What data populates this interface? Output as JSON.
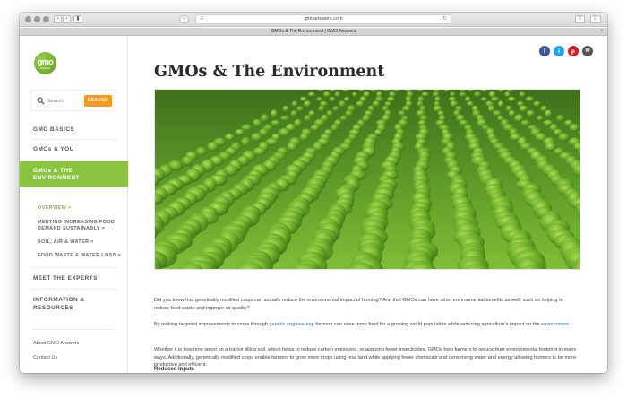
{
  "browser": {
    "url": "gmoanswers.com",
    "tab_title": "GMOs & The Environment | GMO Answers"
  },
  "sidebar": {
    "logo_text": "gmo",
    "logo_sub": "answers",
    "search_placeholder": "Search",
    "search_button": "SEARCH",
    "nav": [
      {
        "label": "GMO BASICS"
      },
      {
        "label": "GMOs & YOU"
      }
    ],
    "active_nav": {
      "line1": "GMOs & THE",
      "line2": "ENVIRONMENT"
    },
    "subnav": [
      {
        "label": "OVERVIEW >"
      },
      {
        "line1": "MEETING INCREASING FOOD",
        "line2": "DEMAND SUSTAINABLY >"
      },
      {
        "label": "SOIL, AIR & WATER >"
      },
      {
        "label": "FOOD WASTE & WATER LOSS >"
      }
    ],
    "nav_after": [
      {
        "label": "MEET THE EXPERTS"
      },
      {
        "line1": "INFORMATION &",
        "line2": "RESOURCES"
      }
    ],
    "footer_links": [
      "About GMO Answers",
      "Contact Us"
    ]
  },
  "main": {
    "title": "GMOs & The Environment",
    "social": [
      {
        "name": "facebook",
        "glyph": "f",
        "color": "#3b5998"
      },
      {
        "name": "twitter",
        "glyph": "t",
        "color": "#1da1f2"
      },
      {
        "name": "pinterest",
        "glyph": "p",
        "color": "#cb2027"
      },
      {
        "name": "email",
        "glyph": "✉",
        "color": "#555555"
      }
    ],
    "para1": "Did you know that genetically modified crops can actually reduce the environmental impact of farming? And that GMOs can have other environmental benefits as well, such as helping to reduce food waste and improve air quality?",
    "para2_before": "By making targeted improvements to crops through ",
    "para2_link1": "genetic engineering",
    "para2_middle": ", farmers can raise more food for a growing world population while reducing agriculture’s impact on the ",
    "para2_link2": "environment",
    "para2_after": ".",
    "para3": "Whether it is less time spent on a tractor tilling soil, which helps to reduce carbon emissions, or applying fewer insecticides, GMOs help farmers to reduce their environmental footprint in many ways.   Additionally, genetically modified crops enable farmers to grow more crops using less land while applying fewer chemicals and conserving water and energy allowing farmers to be more productive and efficient.",
    "subhead": "Reduced Inputs"
  },
  "colors": {
    "accent_green": "#8bc53f",
    "search_orange": "#f39a1e",
    "link_blue": "#2a7abf"
  }
}
